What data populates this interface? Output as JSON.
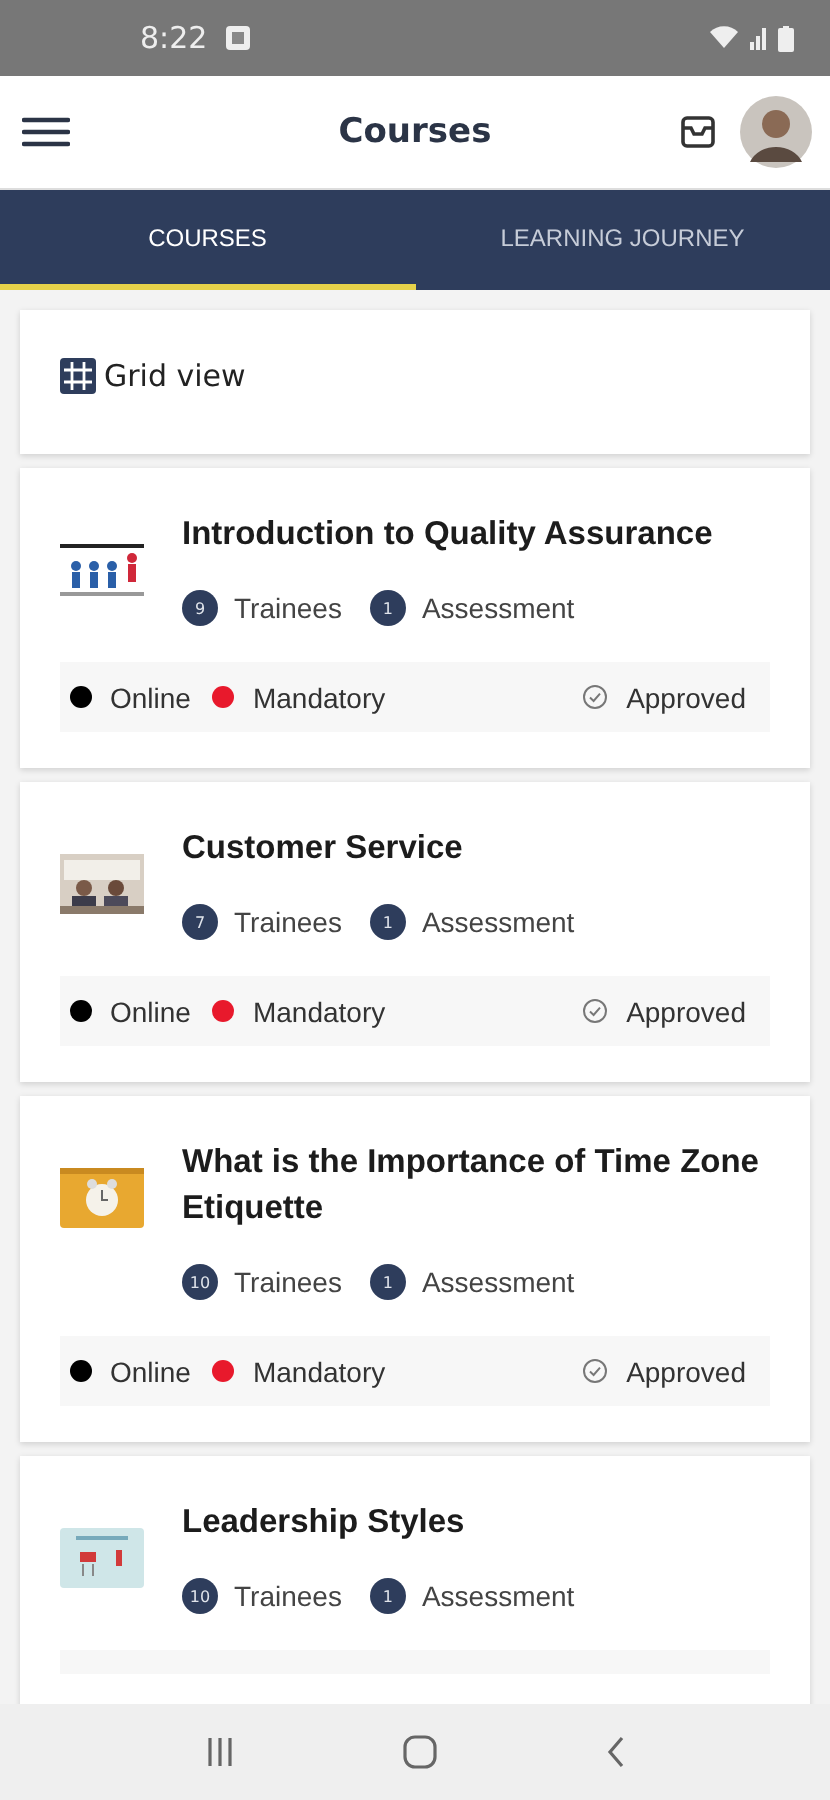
{
  "status_bar": {
    "time": "8:22"
  },
  "app_bar": {
    "title": "Courses"
  },
  "tabs": [
    {
      "label": "COURSES",
      "selected": true
    },
    {
      "label": "LEARNING JOURNEY",
      "selected": false
    }
  ],
  "view_toggle": {
    "label": "Grid view"
  },
  "courses": [
    {
      "title": "Introduction to Quality Assurance",
      "trainees": "9",
      "trainees_label": "Trainees",
      "assessments": "1",
      "assessments_label": "Assessment",
      "tags": [
        {
          "label": "Online",
          "color": "#000000"
        },
        {
          "label": "Mandatory",
          "color": "#e8192c"
        }
      ],
      "status": "Approved"
    },
    {
      "title": "Customer Service",
      "trainees": "7",
      "trainees_label": "Trainees",
      "assessments": "1",
      "assessments_label": "Assessment",
      "tags": [
        {
          "label": "Online",
          "color": "#000000"
        },
        {
          "label": "Mandatory",
          "color": "#e8192c"
        }
      ],
      "status": "Approved"
    },
    {
      "title": "What is the Importance of Time Zone Etiquette",
      "trainees": "10",
      "trainees_label": "Trainees",
      "assessments": "1",
      "assessments_label": "Assessment",
      "tags": [
        {
          "label": "Online",
          "color": "#000000"
        },
        {
          "label": "Mandatory",
          "color": "#e8192c"
        }
      ],
      "status": "Approved"
    },
    {
      "title": "Leadership Styles",
      "trainees": "10",
      "trainees_label": "Trainees",
      "assessments": "1",
      "assessments_label": "Assessment"
    }
  ]
}
